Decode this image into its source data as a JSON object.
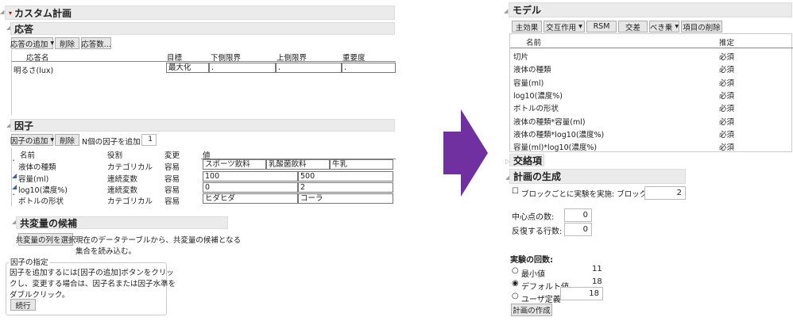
{
  "left": {
    "title": "カスタム計画",
    "responses": {
      "header": "応答",
      "buttons": [
        "応答の追加",
        "削除",
        "応答数..."
      ],
      "columns": [
        "応答名",
        "目標",
        "下側限界",
        "上側限界",
        "重要度"
      ],
      "rows": [
        {
          "name": "明るさ(lux)",
          "goal": "最大化",
          "lower": ".",
          "upper": ".",
          "importance": "."
        }
      ]
    },
    "factors": {
      "header": "因子",
      "buttons": [
        "因子の追加",
        "削除"
      ],
      "add_n_label": "N個の因子を追加",
      "add_n_value": "1",
      "columns": [
        "名前",
        "役割",
        "変更",
        "値"
      ],
      "rows": [
        {
          "name": "液体の種類",
          "role": "カテゴリカル",
          "change": "容易",
          "values": [
            "スポーツ飲料",
            "乳酸菌飲料",
            "牛乳"
          ],
          "icon": "categorical-icon"
        },
        {
          "name": "容量(ml)",
          "role": "連続変数",
          "change": "容易",
          "values": [
            "100",
            "500"
          ],
          "icon": "continuous-icon"
        },
        {
          "name": "log10(濃度%)",
          "role": "連続変数",
          "change": "容易",
          "values": [
            "0",
            "2"
          ],
          "icon": "continuous-icon"
        },
        {
          "name": "ボトルの形状",
          "role": "カテゴリカル",
          "change": "容易",
          "values": [
            "ヒダヒダ",
            "コーラ"
          ],
          "icon": "categorical-icon"
        }
      ]
    },
    "covariates": {
      "header": "共変量の候補",
      "button": "共変量の列を選択",
      "text1": "現在のデータテーブルから、共変量の候補となる",
      "text2": "集合を読み込む。"
    },
    "factor_spec": {
      "legend": "因子の指定",
      "lines": [
        "因子を追加するには[因子の追加]ボタンをクリッ",
        "クし、変更する場合は、因子名または因子水準を",
        "ダブルクリック。"
      ],
      "button": "続行"
    }
  },
  "arrow_color": "#7030a0",
  "right": {
    "model": {
      "header": "モデル",
      "buttons": [
        "主効果",
        "交互作用",
        "RSM",
        "交差",
        "べき乗",
        "項目の削除"
      ],
      "columns": [
        "名前",
        "推定"
      ],
      "rows": [
        [
          "切片",
          "必須"
        ],
        [
          "液体の種類",
          "必須"
        ],
        [
          "容量(ml)",
          "必須"
        ],
        [
          "log10(濃度%)",
          "必須"
        ],
        [
          "ボトルの形状",
          "必須"
        ],
        [
          "液体の種類*容量(ml)",
          "必須"
        ],
        [
          "液体の種類*log10(濃度%)",
          "必須"
        ],
        [
          "容量(ml)*log10(濃度%)",
          "必須"
        ]
      ]
    },
    "confounding": {
      "header": "交絡項"
    },
    "generation": {
      "header": "計画の生成",
      "block_label": "ブロックごとに実験を実施: ブロックサイズ",
      "block_size": "2",
      "center_label": "中心点の数:",
      "center_value": "0",
      "replicate_label": "反復する行数:",
      "replicate_value": "0",
      "runs_label": "実験の回数:",
      "options": [
        {
          "label": "最小値",
          "value": "11",
          "selected": false
        },
        {
          "label": "デフォルト値",
          "value": "18",
          "selected": true
        },
        {
          "label": "ユーザ定義",
          "value": "18",
          "selected": false
        }
      ],
      "make_button": "計画の作成"
    }
  }
}
